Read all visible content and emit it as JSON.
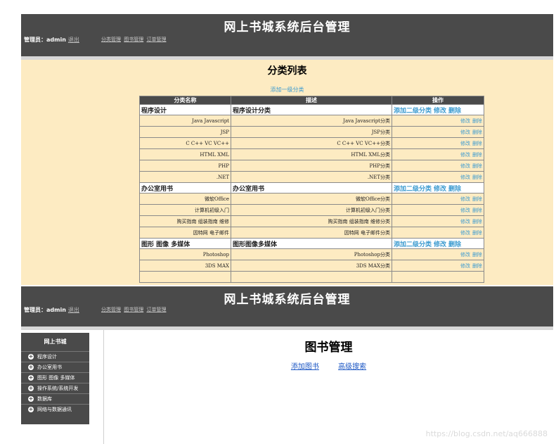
{
  "shot1": {
    "header": {
      "title": "网上书城系统后台管理",
      "admin_prefix": "管理员：admin",
      "logout": "退出",
      "nav": [
        "分类管理",
        "图书管理",
        "订单管理"
      ]
    },
    "page_title": "分类列表",
    "add_top": "添加一级分类",
    "columns": [
      "分类名称",
      "描述",
      "操作"
    ],
    "parent_ops": [
      "添加二级分类",
      "修改",
      "删除"
    ],
    "child_ops": [
      "修改",
      "删除"
    ],
    "groups": [
      {
        "name": "程序设计",
        "desc": "程序设计分类",
        "children": [
          {
            "name": "Java Javascript",
            "desc": "Java Javascript分类"
          },
          {
            "name": "JSP",
            "desc": "JSP分类"
          },
          {
            "name": "C C++ VC VC++",
            "desc": "C C++ VC VC++分类"
          },
          {
            "name": "HTML XML",
            "desc": "HTML XML分类"
          },
          {
            "name": "PHP",
            "desc": "PHP分类"
          },
          {
            "name": ".NET",
            "desc": ".NET分类"
          }
        ]
      },
      {
        "name": "办公室用书",
        "desc": "办公室用书",
        "children": [
          {
            "name": "微软Office",
            "desc": "微软Office分类"
          },
          {
            "name": "计算机初级入门",
            "desc": "计算机初级入门分类"
          },
          {
            "name": "购买指南 组装指南 维修",
            "desc": "购买指南 组装指南 维修分类"
          },
          {
            "name": "因特网 电子邮件",
            "desc": "因特网 电子邮件分类"
          }
        ]
      },
      {
        "name": "图形 图像 多媒体",
        "desc": "图形图像多媒体",
        "children": [
          {
            "name": "Photoshop",
            "desc": "Photoshop分类"
          },
          {
            "name": "3DS MAX",
            "desc": "3DS MAX分类"
          }
        ]
      }
    ]
  },
  "shot2": {
    "header": {
      "title": "网上书城系统后台管理",
      "admin_prefix": "管理员：admin",
      "logout": "退出",
      "nav": [
        "分类管理",
        "图书管理",
        "订单管理"
      ]
    },
    "sidebar": {
      "title": "网上书城",
      "items": [
        "程序设计",
        "办公室用书",
        "图形 图像 多媒体",
        "操作系统/系统开发",
        "数据库",
        "网络与数据通讯"
      ]
    },
    "page_title": "图书管理",
    "links": [
      "添加图书",
      "高级搜索"
    ]
  },
  "watermark": "https://blog.csdn.net/aq666888",
  "colors": {
    "header_bg": "#4a4a4a",
    "content_bg": "#fdebc2",
    "link_blue": "#3c9bd0",
    "link_dark_blue": "#1c57c4"
  }
}
